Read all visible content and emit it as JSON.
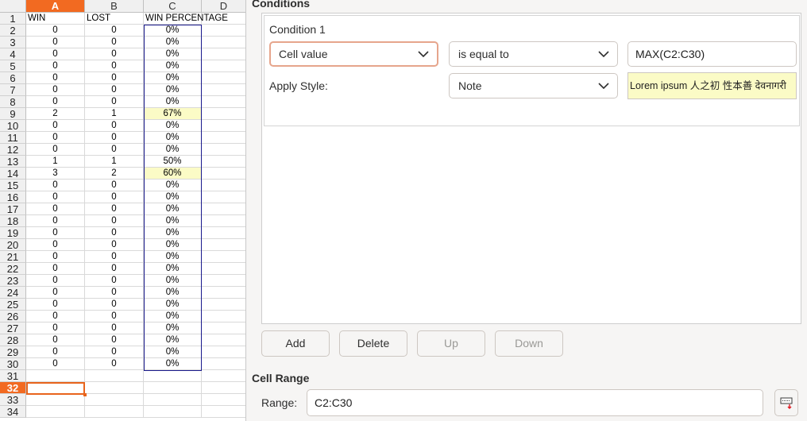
{
  "spreadsheet": {
    "columns": [
      "A",
      "B",
      "C",
      "D"
    ],
    "active_column": "A",
    "active_row": "32",
    "rows": [
      {
        "n": "1",
        "a": "WIN",
        "b": "LOST",
        "c": "WIN PERCENTAGE",
        "hl": false
      },
      {
        "n": "2",
        "a": "0",
        "b": "0",
        "c": "0%",
        "hl": false
      },
      {
        "n": "3",
        "a": "0",
        "b": "0",
        "c": "0%",
        "hl": false
      },
      {
        "n": "4",
        "a": "0",
        "b": "0",
        "c": "0%",
        "hl": false
      },
      {
        "n": "5",
        "a": "0",
        "b": "0",
        "c": "0%",
        "hl": false
      },
      {
        "n": "6",
        "a": "0",
        "b": "0",
        "c": "0%",
        "hl": false
      },
      {
        "n": "7",
        "a": "0",
        "b": "0",
        "c": "0%",
        "hl": false
      },
      {
        "n": "8",
        "a": "0",
        "b": "0",
        "c": "0%",
        "hl": false
      },
      {
        "n": "9",
        "a": "2",
        "b": "1",
        "c": "67%",
        "hl": true
      },
      {
        "n": "10",
        "a": "0",
        "b": "0",
        "c": "0%",
        "hl": false
      },
      {
        "n": "11",
        "a": "0",
        "b": "0",
        "c": "0%",
        "hl": false
      },
      {
        "n": "12",
        "a": "0",
        "b": "0",
        "c": "0%",
        "hl": false
      },
      {
        "n": "13",
        "a": "1",
        "b": "1",
        "c": "50%",
        "hl": false
      },
      {
        "n": "14",
        "a": "3",
        "b": "2",
        "c": "60%",
        "hl": true
      },
      {
        "n": "15",
        "a": "0",
        "b": "0",
        "c": "0%",
        "hl": false
      },
      {
        "n": "16",
        "a": "0",
        "b": "0",
        "c": "0%",
        "hl": false
      },
      {
        "n": "17",
        "a": "0",
        "b": "0",
        "c": "0%",
        "hl": false
      },
      {
        "n": "18",
        "a": "0",
        "b": "0",
        "c": "0%",
        "hl": false
      },
      {
        "n": "19",
        "a": "0",
        "b": "0",
        "c": "0%",
        "hl": false
      },
      {
        "n": "20",
        "a": "0",
        "b": "0",
        "c": "0%",
        "hl": false
      },
      {
        "n": "21",
        "a": "0",
        "b": "0",
        "c": "0%",
        "hl": false
      },
      {
        "n": "22",
        "a": "0",
        "b": "0",
        "c": "0%",
        "hl": false
      },
      {
        "n": "23",
        "a": "0",
        "b": "0",
        "c": "0%",
        "hl": false
      },
      {
        "n": "24",
        "a": "0",
        "b": "0",
        "c": "0%",
        "hl": false
      },
      {
        "n": "25",
        "a": "0",
        "b": "0",
        "c": "0%",
        "hl": false
      },
      {
        "n": "26",
        "a": "0",
        "b": "0",
        "c": "0%",
        "hl": false
      },
      {
        "n": "27",
        "a": "0",
        "b": "0",
        "c": "0%",
        "hl": false
      },
      {
        "n": "28",
        "a": "0",
        "b": "0",
        "c": "0%",
        "hl": false
      },
      {
        "n": "29",
        "a": "0",
        "b": "0",
        "c": "0%",
        "hl": false
      },
      {
        "n": "30",
        "a": "0",
        "b": "0",
        "c": "0%",
        "hl": false
      },
      {
        "n": "31",
        "a": "",
        "b": "",
        "c": "",
        "hl": false
      },
      {
        "n": "32",
        "a": "",
        "b": "",
        "c": "",
        "hl": false
      },
      {
        "n": "33",
        "a": "",
        "b": "",
        "c": "",
        "hl": false
      },
      {
        "n": "34",
        "a": "",
        "b": "",
        "c": "",
        "hl": false
      }
    ]
  },
  "dialog": {
    "conditions_title": "Conditions",
    "condition_label": "Condition 1",
    "condition_type": "Cell value",
    "operator": "is equal to",
    "value": "MAX(C2:C30)",
    "apply_style_label": "Apply Style:",
    "style": "Note",
    "preview_text": "Lorem ipsum  人之初 性本善  देवनागरी",
    "buttons": {
      "add": "Add",
      "delete": "Delete",
      "up": "Up",
      "down": "Down"
    },
    "cell_range_title": "Cell Range",
    "range_label": "Range:",
    "range_value": "C2:C30",
    "colors": {
      "highlight": "#fbfbc6",
      "accent": "#f26a21",
      "selection_border": "#1a1a8c"
    }
  }
}
